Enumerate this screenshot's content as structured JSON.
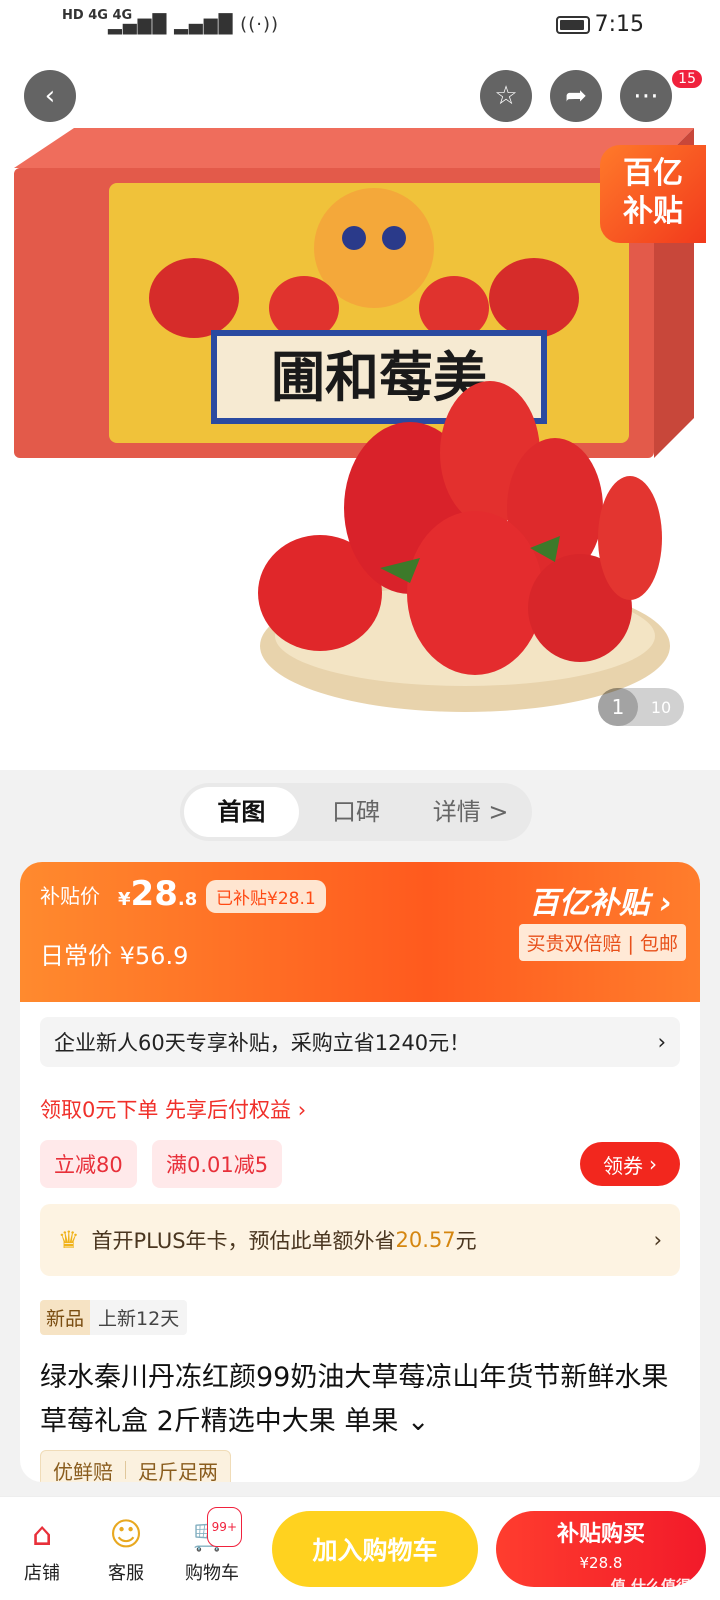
{
  "status_bar": {
    "network_left": "HD 4G 4G",
    "time": "7:15"
  },
  "hero": {
    "box_caption": "圃和莓美",
    "subsidy_tag_line1": "百亿",
    "subsidy_tag_line2": "补贴",
    "more_badge": "15",
    "pager_current": "1",
    "pager_total": "10"
  },
  "tabs": [
    {
      "label": "首图"
    },
    {
      "label": "口碑"
    },
    {
      "label": "详情 >"
    }
  ],
  "price": {
    "subsidy_label": "补贴价",
    "currency": "¥",
    "subsidy_int": "28",
    "subsidy_dec": ".8",
    "already_subsidy": "已补贴¥28.1",
    "regular_label": "日常价",
    "regular_price": "¥56.9",
    "brand": "百亿补贴",
    "guarantee": "买贵双倍赔 | 包邮"
  },
  "promo": {
    "enterprise_banner": "企业新人60天专享补贴，采购立省1240元！",
    "pay_later": "领取0元下单 先享后付权益 ›",
    "chip1": "立减80",
    "chip2": "满0.01减5",
    "coupon_button": "领券",
    "plus_prefix": "首开PLUS年卡，预估此单额外省",
    "plus_amount": "20.57",
    "plus_suffix": "元"
  },
  "product": {
    "tag_new": "新品",
    "tag_days": "上新12天",
    "title": "绿水秦川丹冻红颜99奶油大草莓凉山年货节新鲜水果草莓礼盒 2斤精选中大果  单果 ⌄",
    "assure1": "优鲜赔",
    "assure2": "足斤足两"
  },
  "bottom_bar": {
    "store": "店铺",
    "service": "客服",
    "cart": "购物车",
    "cart_badge": "99+",
    "add_to_cart": "加入购物车",
    "buy_now": "补贴购买",
    "buy_price": "¥28.8",
    "watermark": "值 什么值得买"
  },
  "colors": {
    "accent_orange": "#ff5a1e",
    "accent_red": "#f2271e",
    "cart_yellow": "#ffd21f"
  }
}
